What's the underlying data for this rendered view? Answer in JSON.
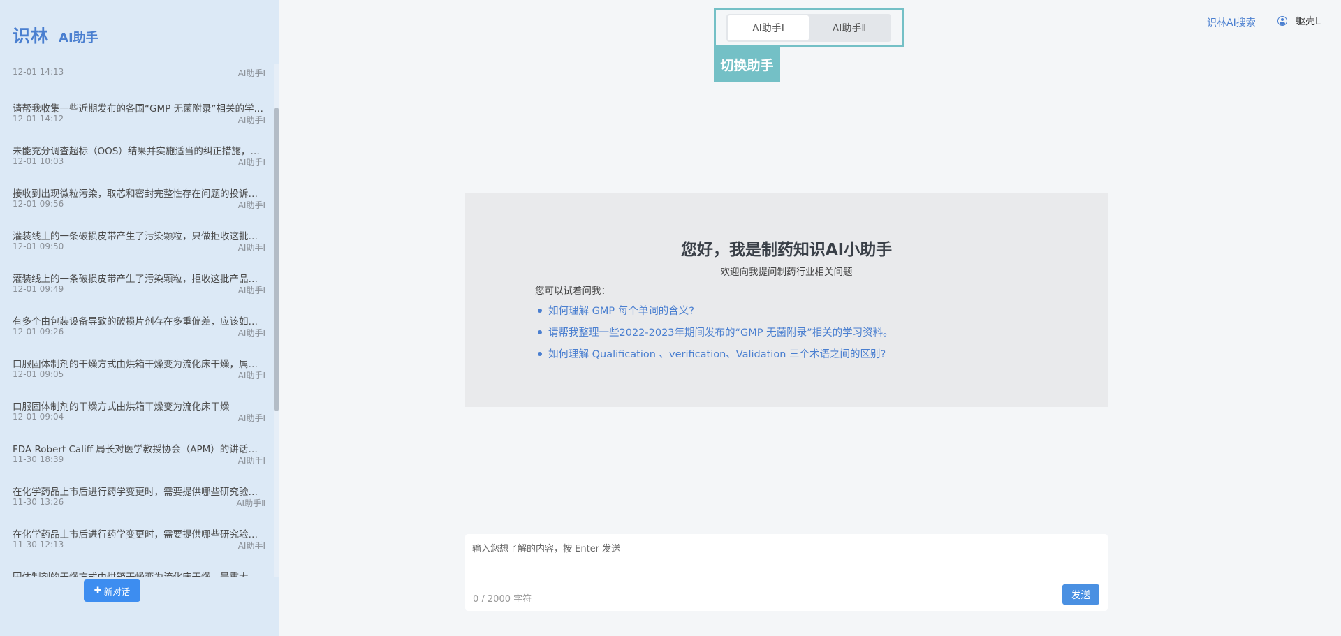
{
  "sidebar": {
    "brand_main": "识林",
    "brand_sub": "AI助手",
    "new_chat_label": "新对话",
    "conversations": [
      {
        "title": "",
        "time": "12-01 14:13",
        "tag": "AI助手Ⅰ"
      },
      {
        "title": "请帮我收集一些近期发布的各国“GMP 无菌附录”相关的学习资料",
        "time": "12-01 14:12",
        "tag": "AI助手Ⅰ"
      },
      {
        "title": "未能充分调查超标（OOS）结果并实施适当的纠正措施，该如何处理",
        "time": "12-01 10:03",
        "tag": "AI助手Ⅰ"
      },
      {
        "title": "接收到出现微粒污染，取芯和密封完整性存在问题的投诉，该如何处理",
        "time": "12-01 09:56",
        "tag": "AI助手Ⅰ"
      },
      {
        "title": "灌装线上的一条破损皮带产生了污染颗粒，只做拒收这批产品是否足够",
        "time": "12-01 09:50",
        "tag": "AI助手Ⅰ"
      },
      {
        "title": "灌装线上的一条破损皮带产生了污染颗粒，拒收这批产品后还需要做什么",
        "time": "12-01 09:49",
        "tag": "AI助手Ⅰ"
      },
      {
        "title": "有多个由包装设备导致的破损片剂存在多重偏差，应该如何处理",
        "time": "12-01 09:26",
        "tag": "AI助手Ⅰ"
      },
      {
        "title": "口服固体制剂的干燥方式由烘箱干燥变为流化床干燥，属于什么变更",
        "time": "12-01 09:05",
        "tag": "AI助手Ⅰ"
      },
      {
        "title": "口服固体制剂的干燥方式由烘箱干燥变为流化床干燥",
        "time": "12-01 09:04",
        "tag": "AI助手Ⅰ"
      },
      {
        "title": "FDA Robert Califf 局长对医学教授协会（APM）的讲话要点",
        "time": "11-30 18:39",
        "tag": "AI助手Ⅰ"
      },
      {
        "title": "在化学药品上市后进行药学变更时，需要提供哪些研究验证资料",
        "time": "11-30 13:26",
        "tag": "AI助手Ⅱ"
      },
      {
        "title": "在化学药品上市后进行药学变更时，需要提供哪些研究验证资料",
        "time": "11-30 12:13",
        "tag": "AI助手Ⅰ"
      },
      {
        "title": "固体制剂的干燥方式由烘箱干燥变为流化床干燥，是重大变更吗",
        "time": "",
        "tag": ""
      }
    ]
  },
  "switcher": {
    "tabs": [
      {
        "label": "AI助手Ⅰ",
        "active": true
      },
      {
        "label": "AI助手Ⅱ",
        "active": false
      }
    ],
    "annotation": "切换助手"
  },
  "header": {
    "search_link": "识林AI搜索",
    "username": "躯壳L"
  },
  "welcome": {
    "title": "您好，我是制药知识AI小助手",
    "subtitle": "欢迎向我提问制药行业相关问题",
    "try_label": "您可以试着问我：",
    "suggestions": [
      "如何理解 GMP 每个单词的含义?",
      "请帮我整理一些2022-2023年期间发布的“GMP 无菌附录”相关的学习资料。",
      "如何理解 Qualification 、verification、Validation 三个术语之间的区别?"
    ]
  },
  "input": {
    "placeholder": "输入您想了解的内容，按 Enter 发送",
    "value": "",
    "counter": "0 / 2000 字符",
    "send_label": "发送"
  },
  "colors": {
    "accent": "#4a7fd0",
    "sidebar_bg": "#dce9f6",
    "annotation": "#74c0c6",
    "new_chat_button": "#3d8df0"
  }
}
